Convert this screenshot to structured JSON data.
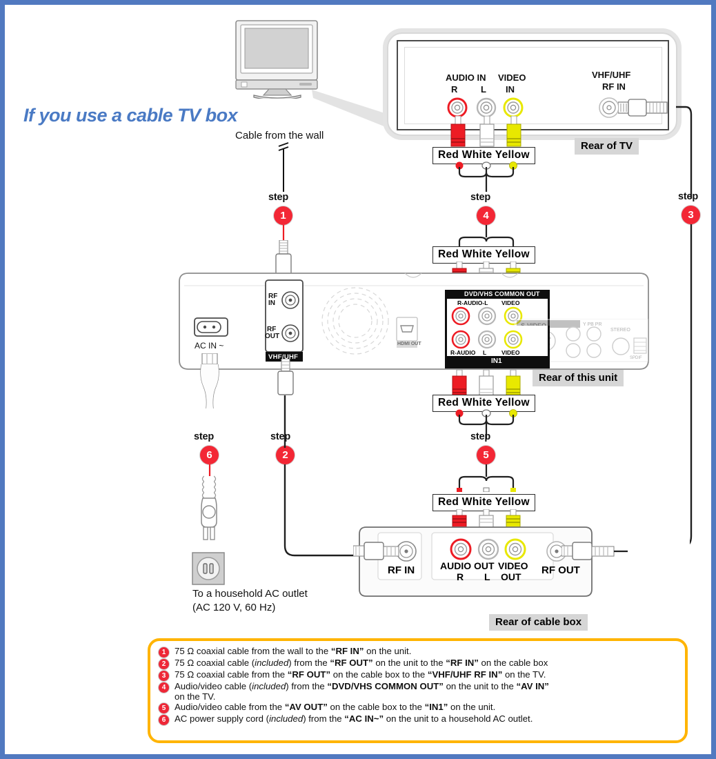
{
  "page": {
    "title": "If you use a cable TV box",
    "border_color": "#5179c0"
  },
  "labels": {
    "cable_from_wall": "Cable from the wall",
    "rear_of_tv": "Rear of TV",
    "rear_of_unit": "Rear of this unit",
    "rear_of_cable_box": "Rear of cable box",
    "ac_outlet_line1": "To a household AC outlet",
    "ac_outlet_line2": "(AC 120 V, 60 Hz)",
    "rwy": "Red White Yellow",
    "step_word": "step"
  },
  "tv_panel": {
    "audio_in": "AUDIO IN",
    "audio_r": "R",
    "audio_l": "L",
    "video_in_line1": "VIDEO",
    "video_in_line2": "IN",
    "rf_in_line1": "VHF/UHF",
    "rf_in_line2": "RF IN"
  },
  "unit_panel": {
    "ac_in": "AC IN ~",
    "rf_in_line1": "RF",
    "rf_in_line2": "IN",
    "rf_out_line1": "RF",
    "rf_out_line2": "OUT",
    "vhf_uhf": "VHF/UHF",
    "hdmi": "HDMI OUT",
    "common_out_header": "DVD/VHS COMMON OUT",
    "common_out_audio": "R-AUDIO-L",
    "common_out_video": "VIDEO",
    "in1_audio_r": "R-AUDIO",
    "in1_audio_l": "L",
    "in1_video": "VIDEO",
    "in1_footer": "IN1",
    "s_video": "S-VIDEO",
    "y": "Y",
    "pb": "PB",
    "pr": "PR",
    "stereo": "STEREO",
    "spdif": "SPDIF"
  },
  "cable_box_panel": {
    "rf_in": "RF IN",
    "audio_out_1": "AUDIO OUT",
    "audio_out_r": "R",
    "audio_out_l": "L",
    "video_out_line1": "VIDEO",
    "video_out_line2": "OUT",
    "rf_out": "RF OUT"
  },
  "steps": [
    {
      "number": "1",
      "label": "step"
    },
    {
      "number": "2",
      "label": "step"
    },
    {
      "number": "3",
      "label": "step"
    },
    {
      "number": "4",
      "label": "step"
    },
    {
      "number": "5",
      "label": "step"
    },
    {
      "number": "6",
      "label": "step"
    }
  ],
  "legend": [
    {
      "number": "1",
      "html": "75 &#937; coaxial cable from the wall to the <b>&#8220;RF IN&#8221;</b> on the unit."
    },
    {
      "number": "2",
      "html": "75 &#937; coaxial cable (<i>included</i>) from the <b>&#8220;RF OUT&#8221;</b> on the unit to the <b>&#8220;RF IN&#8221;</b> on the cable box"
    },
    {
      "number": "3",
      "html": "75 &#937; coaxial cable from the <b>&#8220;RF OUT&#8221;</b> on the cable box to the <b>&#8220;VHF/UHF RF IN&#8221;</b> on the TV."
    },
    {
      "number": "4",
      "html": "Audio/video cable (<i>included</i>) from the <b>&#8220;DVD/VHS COMMON OUT&#8221;</b> on the unit to the <b>&#8220;AV IN&#8221;</b><br>on the TV."
    },
    {
      "number": "5",
      "html": "Audio/video cable from the <b>&#8220;AV OUT&#8221;</b> on the cable box to the <b>&#8220;IN1&#8221;</b> on the unit."
    },
    {
      "number": "6",
      "html": "AC power supply cord (<i>included</i>) from the <b>&#8220;AC IN~&#8221;</b> on the unit to a household AC outlet."
    }
  ],
  "colors": {
    "red": "#ed1c24",
    "yellow": "#e8e800",
    "white": "#ffffff",
    "step_red": "#f32735",
    "legend_border": "#ffb400",
    "title_blue": "#4a7ac4"
  }
}
